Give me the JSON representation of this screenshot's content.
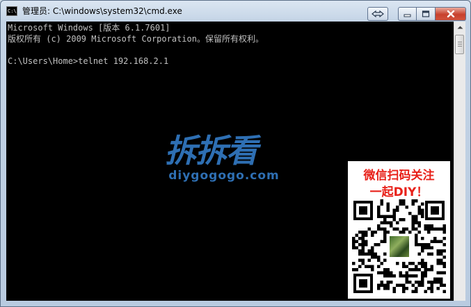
{
  "window": {
    "title": "管理员: C:\\windows\\system32\\cmd.exe",
    "icon": "cmd-app-icon",
    "icon_text": "C:\\",
    "controls": {
      "restore": "restore-icon",
      "minimize": "minimize-icon",
      "maximize": "maximize-icon",
      "close": "close-icon"
    }
  },
  "console": {
    "lines": [
      "Microsoft Windows [版本 6.1.7601]",
      "版权所有 (c) 2009 Microsoft Corporation。保留所有权利。",
      "",
      "C:\\Users\\Home>telnet 192.168.2.1"
    ],
    "text_color": "#c0c0c0",
    "background": "#000000"
  },
  "watermark": {
    "logo_text": "拆拆看",
    "site": "diygogogo.com",
    "color": "#2e6fb3"
  },
  "qr_promo": {
    "line1": "微信扫码关注",
    "line2": "一起DIY！",
    "accent": "#e8211a"
  }
}
